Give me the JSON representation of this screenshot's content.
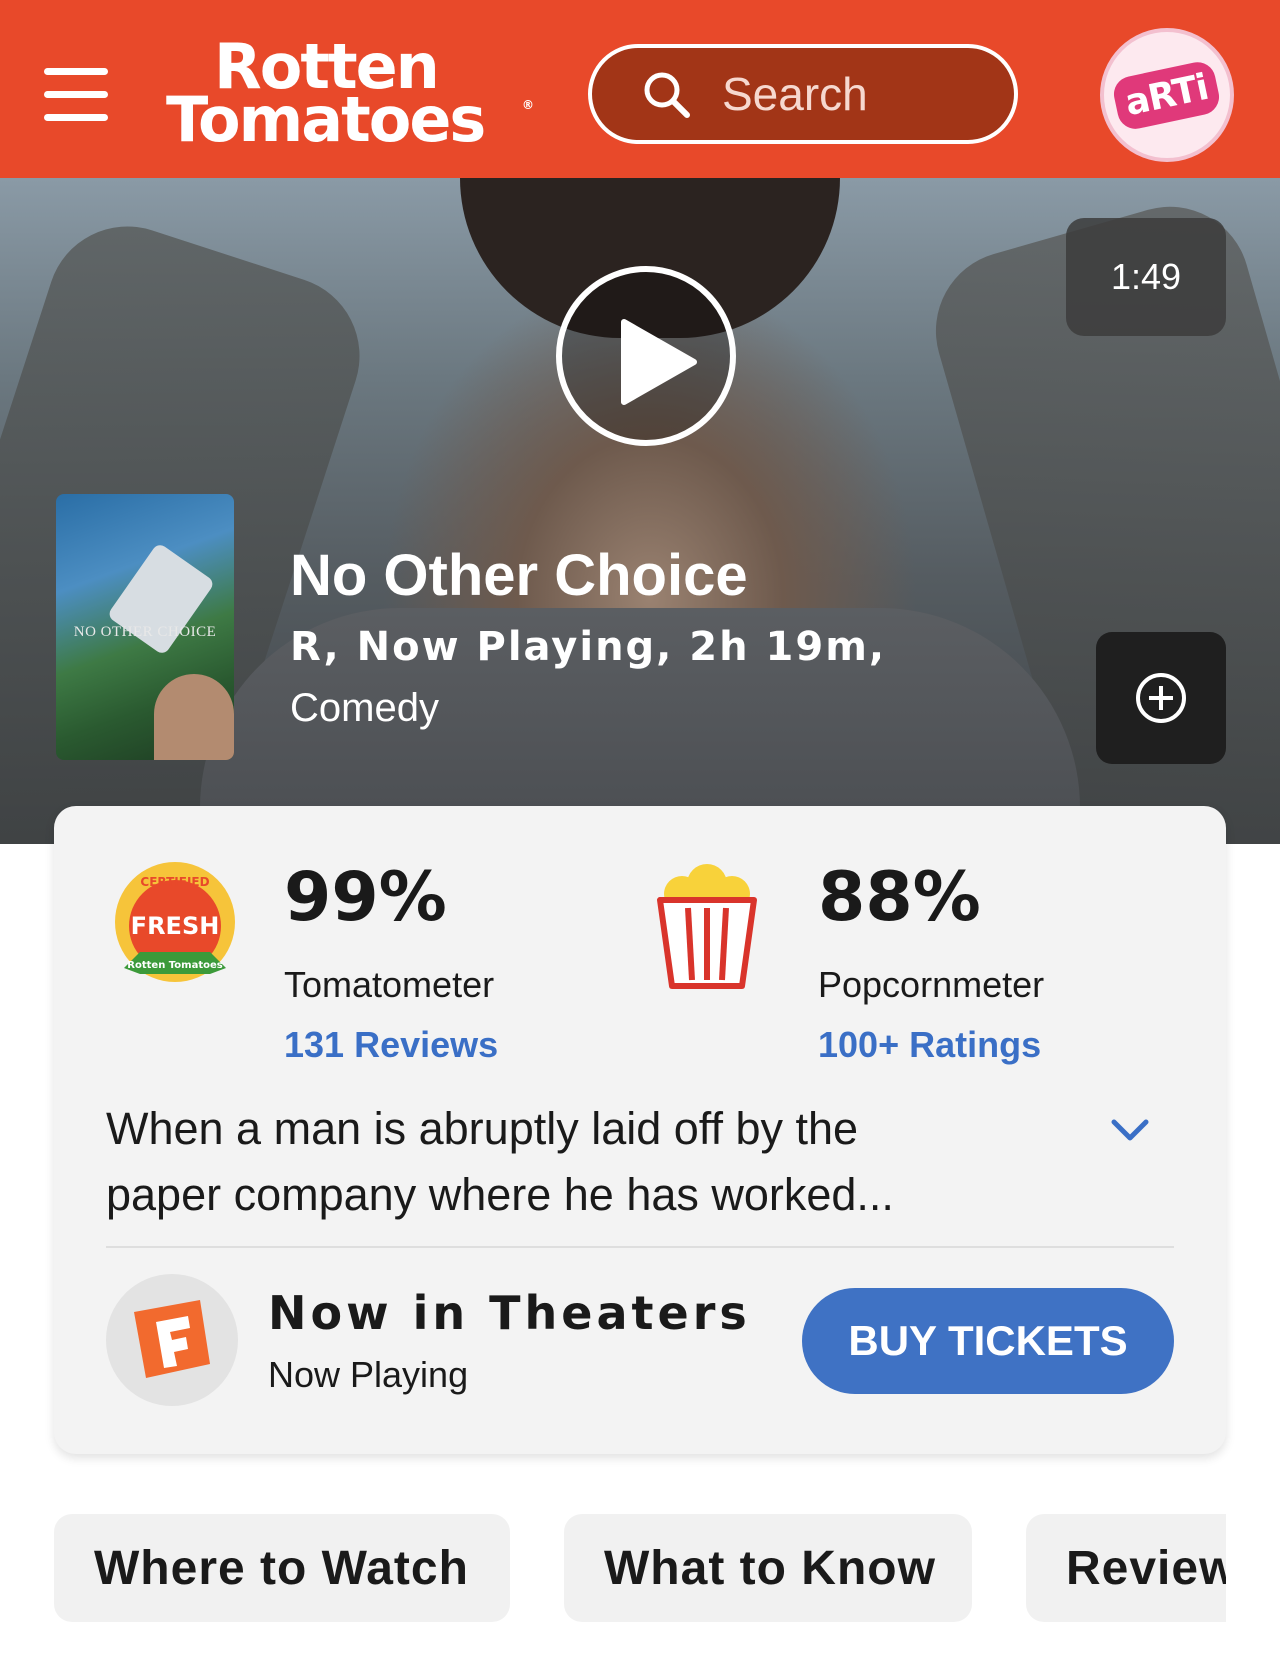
{
  "header": {
    "logo_line1": "Rotten",
    "logo_line2": "Tomatoes",
    "search_placeholder": "Search",
    "avatar_text": "aRTi",
    "brand_color": "#e8492a"
  },
  "hero": {
    "video_duration": "1:49",
    "poster_title": "NO OTHER CHOICE",
    "title": "No Other Choice",
    "meta_line1": "R, Now Playing, 2h 19m,",
    "meta_line2": "Comedy"
  },
  "scores": {
    "tomatometer": {
      "badge_top": "CERTIFIED",
      "badge_mid": "FRESH",
      "badge_bottom": "Rotten Tomatoes",
      "percent": "99%",
      "label": "Tomatometer",
      "link": "131 Reviews"
    },
    "popcornmeter": {
      "percent": "88%",
      "label": "Popcornmeter",
      "link": "100+ Ratings"
    }
  },
  "synopsis": {
    "line1": "When a man is abruptly laid off by the",
    "line2": "paper company where he has worked..."
  },
  "theaters": {
    "title": "Now in Theaters",
    "subtitle": "Now Playing",
    "button": "BUY TICKETS",
    "button_color": "#3f72c4"
  },
  "tabs": [
    {
      "label": "Where to Watch"
    },
    {
      "label": "What to Know"
    },
    {
      "label": "Reviews"
    }
  ]
}
